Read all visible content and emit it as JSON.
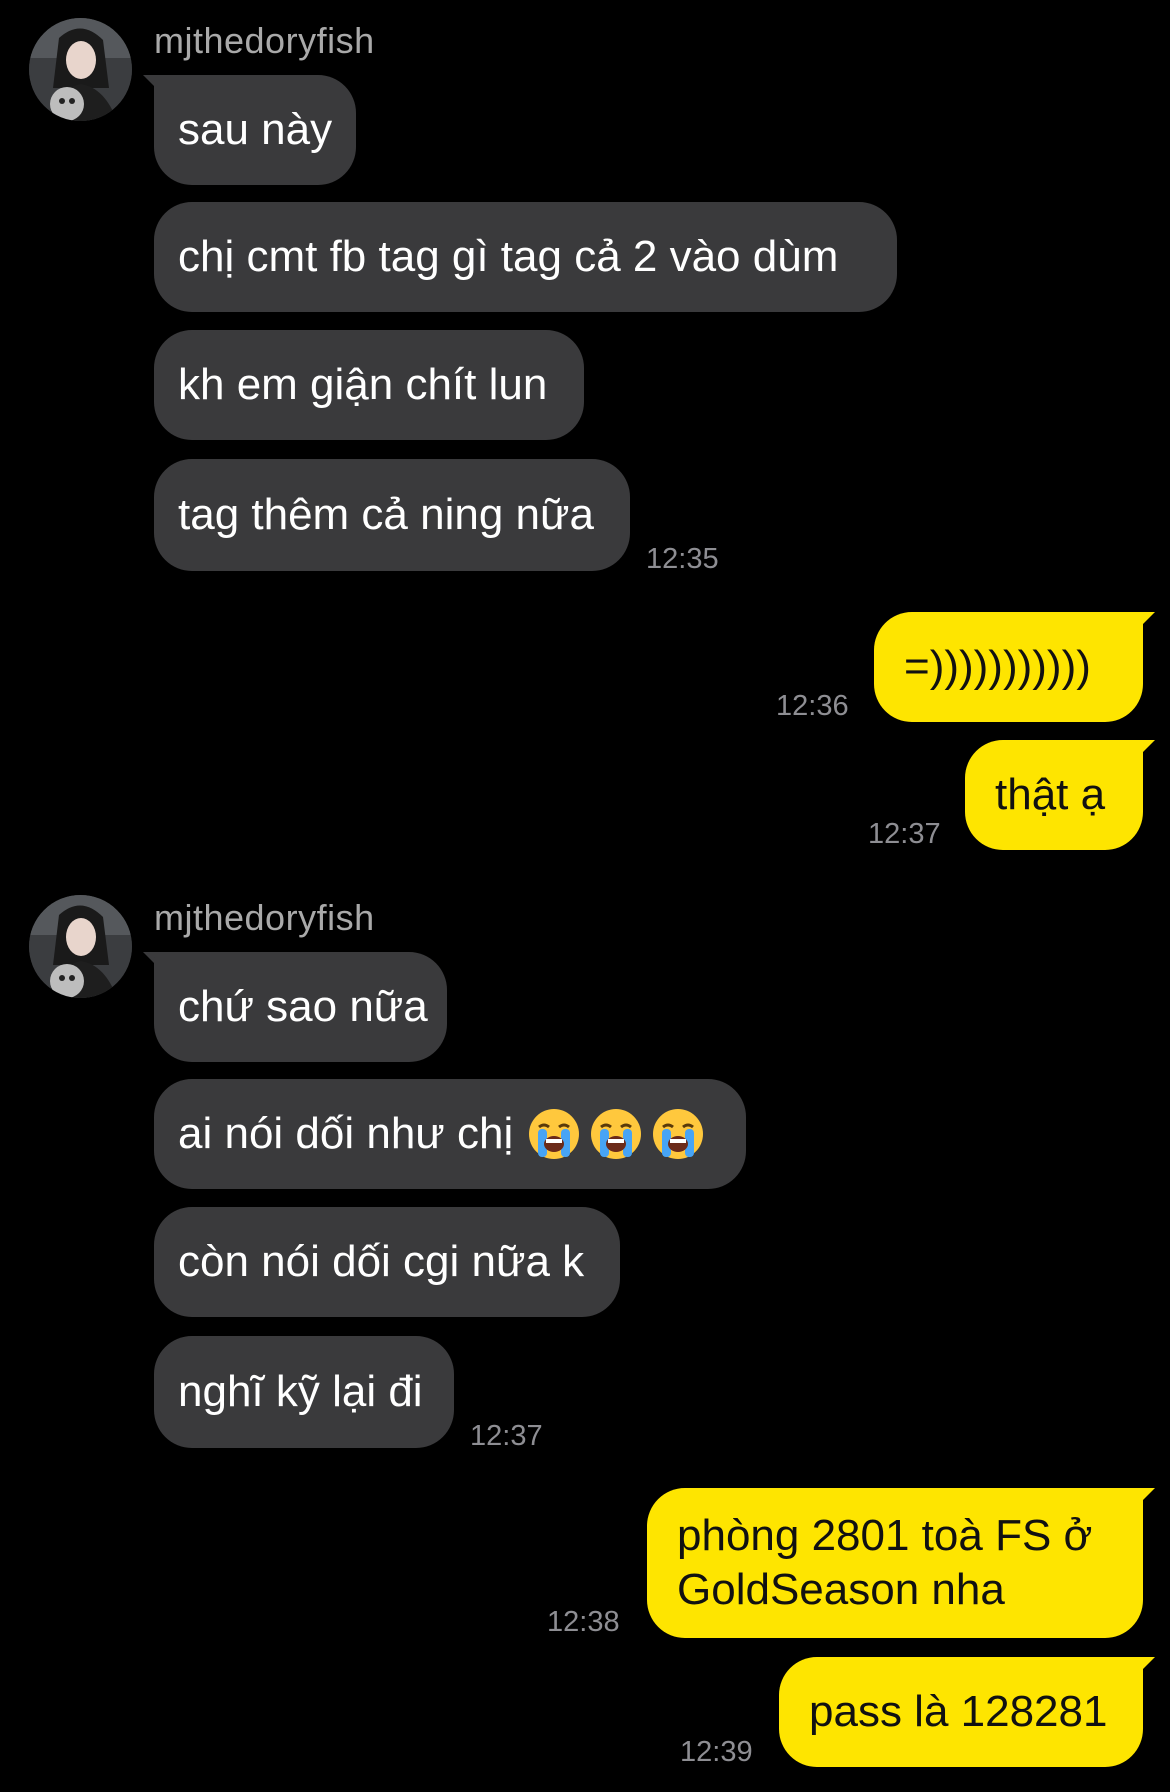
{
  "messages": [
    {
      "sender": "mjthedoryfish"
    },
    {
      "text": "sau này"
    },
    {
      "text": "chị cmt fb tag gì tag cả 2 vào dùm"
    },
    {
      "text": "kh em giận chít lun"
    },
    {
      "text": "tag thêm cả ning nữa",
      "time": "12:35"
    },
    {
      "text": "=)))))))))))",
      "time": "12:36"
    },
    {
      "text": "thật ạ",
      "time": "12:37"
    },
    {
      "sender": "mjthedoryfish"
    },
    {
      "text": "chứ sao nữa"
    },
    {
      "text": "ai nói dối như chị",
      "emoji": "loudly-crying-face-icon"
    },
    {
      "text": "còn nói dối cgi nữa k"
    },
    {
      "text": "nghĩ kỹ lại đi",
      "time": "12:37"
    },
    {
      "text": "phòng 2801 toà FS ở GoldSeason nha",
      "time": "12:38"
    },
    {
      "text": "pass là 128281",
      "time": "12:39"
    }
  ],
  "colors": {
    "background": "#000000",
    "incoming_bubble": "#3a3a3c",
    "outgoing_bubble": "#fee500",
    "timestamp": "#8e8e93",
    "sender_name": "#a9a9a9"
  }
}
